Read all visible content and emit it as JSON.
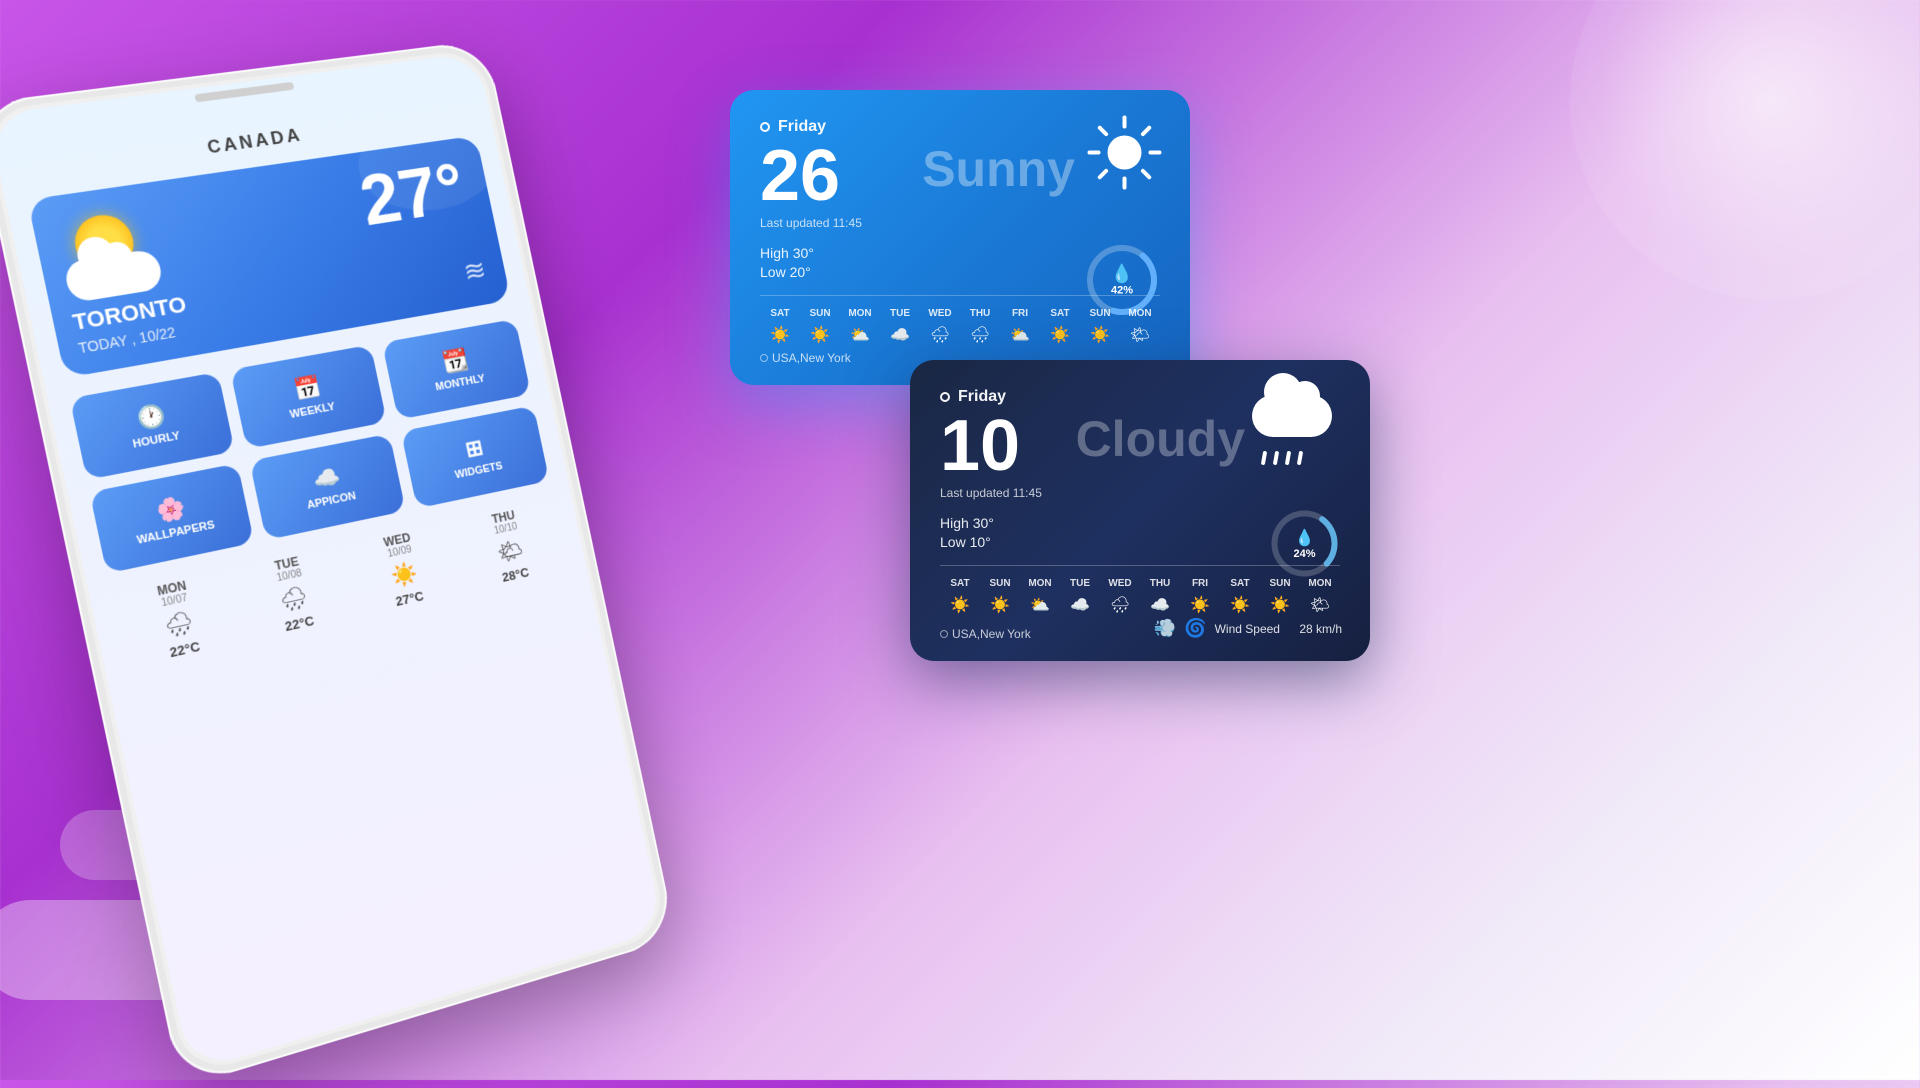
{
  "background": {
    "gradient_start": "#c855e8",
    "gradient_end": "#ffffff"
  },
  "phone": {
    "location": "CANADA",
    "weather_card": {
      "temperature": "27°",
      "city": "TORONTO",
      "date": "TODAY , 10/22",
      "wind_symbol": "≋"
    },
    "buttons": [
      {
        "id": "hourly",
        "label": "HOURLY",
        "icon": "🕐"
      },
      {
        "id": "weekly",
        "label": "WEEKLY",
        "icon": "📅"
      },
      {
        "id": "monthly",
        "label": "MONTHLY",
        "icon": "📆"
      },
      {
        "id": "wallpapers",
        "label": "WALLPAPERS",
        "icon": "🌸"
      },
      {
        "id": "appicon",
        "label": "APPICON",
        "icon": "☁️"
      },
      {
        "id": "widgets",
        "label": "WIDGETS",
        "icon": "⊞"
      }
    ],
    "forecast": [
      {
        "day": "MON",
        "date": "10/07",
        "icon": "🌧",
        "temp": "22°C"
      },
      {
        "day": "TUE",
        "date": "10/08",
        "icon": "🌧",
        "temp": "22°C"
      },
      {
        "day": "WED",
        "date": "10/09",
        "icon": "☀️",
        "temp": "27°C"
      },
      {
        "day": "THU",
        "date": "10/10",
        "icon": "🌤",
        "temp": "28°C"
      }
    ]
  },
  "card_blue": {
    "day": "Friday",
    "temp": "26",
    "last_updated_label": "Last updated 11:45",
    "condition": "Sunny",
    "high": "30°",
    "low": "20°",
    "high_label": "High",
    "low_label": "Low",
    "humidity_pct": "42%",
    "location": "USA,New York",
    "week_days": [
      "SAT",
      "SUN",
      "MON",
      "TUE",
      "WED",
      "THU",
      "FRI",
      "SAT",
      "SUN",
      "MON"
    ],
    "week_icons": [
      "☀️",
      "☀️",
      "⛅",
      "☁️",
      "🌧",
      "🌧",
      "⛅",
      "☀️",
      "☀️",
      "🌤"
    ]
  },
  "card_dark": {
    "day": "Friday",
    "temp": "10",
    "last_updated_label": "Last updated 11:45",
    "condition": "Cloudy",
    "high": "30°",
    "low": "10°",
    "high_label": "High",
    "low_label": "Low",
    "humidity_pct": "24%",
    "location": "USA,New York",
    "wind_speed_label": "Wind Speed",
    "wind_speed_value": "28 km/h",
    "week_days": [
      "SAT",
      "SUN",
      "MON",
      "TUE",
      "WED",
      "THU",
      "FRI",
      "SAT",
      "SUN",
      "MON"
    ],
    "week_icons": [
      "☀️",
      "☀️",
      "⛅",
      "☁️",
      "🌧",
      "☁️",
      "☀️",
      "☀️",
      "☀️",
      "🌤"
    ]
  }
}
